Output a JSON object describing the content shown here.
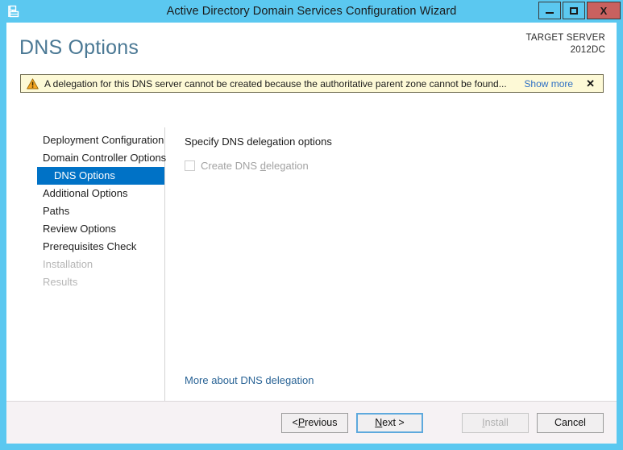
{
  "window": {
    "title": "Active Directory Domain Services Configuration Wizard",
    "app_icon": "server-wizard-icon",
    "accent_color": "#5bc8f0",
    "controls": {
      "minimize_label": "Minimize",
      "maximize_label": "Maximize",
      "close_label": "X"
    }
  },
  "header": {
    "page_title": "DNS Options",
    "target_server_label": "TARGET SERVER",
    "target_server_name": "2012DC",
    "title_color": "#4a7894"
  },
  "banner": {
    "icon": "warning-triangle-icon",
    "message": "A delegation for this DNS server cannot be created because the authoritative parent zone cannot be found...",
    "show_more_label": "Show more",
    "close_label": "✕",
    "background_color": "#fdf9d6",
    "link_color": "#2d6fc4"
  },
  "nav": {
    "selected_color": "#0072c6",
    "items": [
      {
        "label": "Deployment Configuration",
        "state": "normal"
      },
      {
        "label": "Domain Controller Options",
        "state": "normal"
      },
      {
        "label": "DNS Options",
        "state": "selected"
      },
      {
        "label": "Additional Options",
        "state": "normal"
      },
      {
        "label": "Paths",
        "state": "normal"
      },
      {
        "label": "Review Options",
        "state": "normal"
      },
      {
        "label": "Prerequisites Check",
        "state": "normal"
      },
      {
        "label": "Installation",
        "state": "disabled"
      },
      {
        "label": "Results",
        "state": "disabled"
      }
    ]
  },
  "content": {
    "heading": "Specify DNS delegation options",
    "checkbox": {
      "label_before": "Create DNS ",
      "label_accel": "d",
      "label_after": "elegation",
      "checked": false,
      "enabled": false
    },
    "more_link": "More about DNS delegation"
  },
  "footer": {
    "buttons": [
      {
        "before": "< ",
        "accel": "P",
        "after": "revious",
        "state": "normal",
        "name": "previous-button"
      },
      {
        "before": "",
        "accel": "N",
        "after": "ext >",
        "state": "focused",
        "name": "next-button"
      },
      {
        "before": "",
        "accel": "I",
        "after": "nstall",
        "state": "disabled",
        "name": "install-button"
      },
      {
        "before": "",
        "accel": "",
        "after": "Cancel",
        "state": "normal",
        "name": "cancel-button"
      }
    ]
  }
}
